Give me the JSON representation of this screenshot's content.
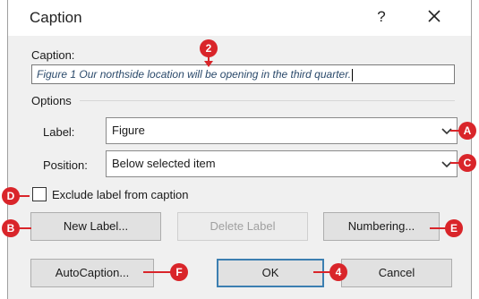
{
  "dialog": {
    "title": "Caption",
    "help": "?",
    "caption_label": "Caption:",
    "caption_value": "Figure 1 Our northside location will be opening in the third quarter.",
    "options_label": "Options",
    "label_label": "Label:",
    "label_value": "Figure",
    "position_label": "Position:",
    "position_value": "Below selected item",
    "exclude_label": "Exclude label from caption",
    "exclude_checked": false,
    "buttons": {
      "new_label": "New Label...",
      "delete_label": "Delete Label",
      "numbering": "Numbering...",
      "autocaption": "AutoCaption...",
      "ok": "OK",
      "cancel": "Cancel"
    }
  },
  "callouts": {
    "two": "2",
    "a": "A",
    "c": "C",
    "d": "D",
    "b": "B",
    "e": "E",
    "f": "F",
    "four": "4"
  },
  "colors": {
    "callout": "#d9252a",
    "dialog_bg": "#f0f0f0",
    "default_button_border": "#3c7fb1"
  },
  "icons": [
    "close-icon",
    "chevron-down-icon",
    "checkbox-icon"
  ]
}
